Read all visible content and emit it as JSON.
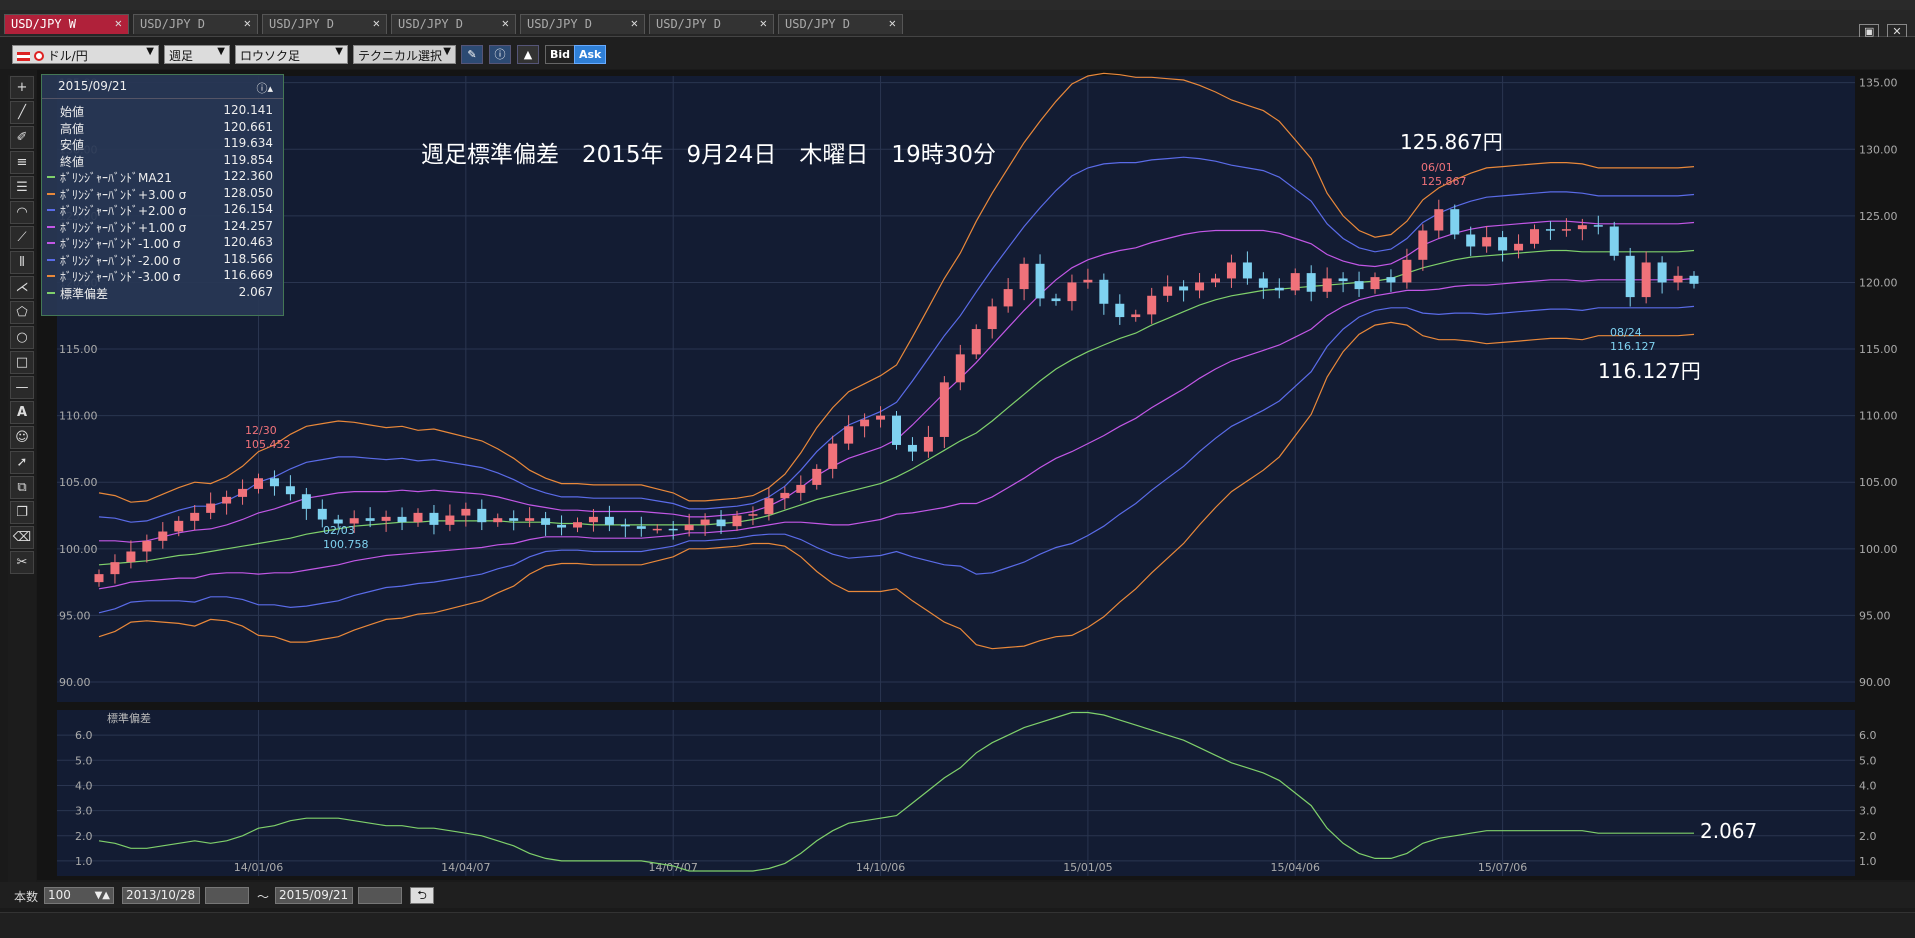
{
  "tabs": [
    {
      "label": "USD/JPY W",
      "active": true
    },
    {
      "label": "USD/JPY D",
      "active": false
    },
    {
      "label": "USD/JPY D",
      "active": false
    },
    {
      "label": "USD/JPY D",
      "active": false
    },
    {
      "label": "USD/JPY D",
      "active": false
    },
    {
      "label": "USD/JPY D",
      "active": false
    },
    {
      "label": "USD/JPY D",
      "active": false
    }
  ],
  "tab_close": "✕",
  "toolbar": {
    "currency": "ドル/円",
    "period": "週足",
    "chart_type": "ロウソク足",
    "technical": "テクニカル選択",
    "bid": "Bid",
    "ask": "Ask"
  },
  "title_overlay": "週足標準偏差　2015年　9月24日　木曜日　19時30分",
  "annotations": {
    "high_price": "125.867円",
    "low_price": "116.127円",
    "stdev_value": "2.067",
    "label_1230_date": "12/30",
    "label_1230_value": "105.452",
    "label_0203_date": "02/03",
    "label_0203_value": "100.758",
    "label_0601_date": "06/01",
    "label_0601_value": "125.867",
    "label_0824_date": "08/24",
    "label_0824_value": "116.127"
  },
  "info_panel": {
    "date": "2015/09/21",
    "rows": [
      {
        "label": "始値",
        "value": "120.141",
        "color": ""
      },
      {
        "label": "高値",
        "value": "120.661",
        "color": ""
      },
      {
        "label": "安値",
        "value": "119.634",
        "color": ""
      },
      {
        "label": "終値",
        "value": "119.854",
        "color": ""
      },
      {
        "label": "ﾎﾞﾘﾝｼﾞｬｰﾊﾞﾝﾄﾞMA21",
        "value": "122.360",
        "color": "#7fd06b"
      },
      {
        "label": "ﾎﾞﾘﾝｼﾞｬｰﾊﾞﾝﾄﾞ+3.00 σ",
        "value": "128.050",
        "color": "#e9883a"
      },
      {
        "label": "ﾎﾞﾘﾝｼﾞｬｰﾊﾞﾝﾄﾞ+2.00 σ",
        "value": "126.154",
        "color": "#5a6be8"
      },
      {
        "label": "ﾎﾞﾘﾝｼﾞｬｰﾊﾞﾝﾄﾞ+1.00 σ",
        "value": "124.257",
        "color": "#c257e6"
      },
      {
        "label": "ﾎﾞﾘﾝｼﾞｬｰﾊﾞﾝﾄﾞ-1.00 σ",
        "value": "120.463",
        "color": "#c257e6"
      },
      {
        "label": "ﾎﾞﾘﾝｼﾞｬｰﾊﾞﾝﾄﾞ-2.00 σ",
        "value": "118.566",
        "color": "#5a6be8"
      },
      {
        "label": "ﾎﾞﾘﾝｼﾞｬｰﾊﾞﾝﾄﾞ-3.00 σ",
        "value": "116.669",
        "color": "#e9883a"
      },
      {
        "label": "標準偏差",
        "value": "2.067",
        "color": "#7fd06b"
      }
    ]
  },
  "bottom": {
    "count_label": "本数",
    "count_value": "100",
    "from_date": "2013/10/28",
    "tilde": "～",
    "to_date": "2015/09/21"
  },
  "colors": {
    "bg": "#131c33",
    "up": "#f0727a",
    "down": "#7fd2f0",
    "ma": "#7fd06b",
    "s1": "#c257e6",
    "s2": "#5a6be8",
    "s3": "#e9883a",
    "grid": "#2a3550"
  },
  "chart_data": {
    "type": "candlestick",
    "main_yticks": [
      "135.00",
      "130.00",
      "125.00",
      "120.00",
      "115.00",
      "110.00",
      "105.00",
      "100.00",
      "95.00",
      "90.00"
    ],
    "main_yrange": [
      88.5,
      135.5
    ],
    "xlabels": [
      {
        "i": 10,
        "label": "14/01/06"
      },
      {
        "i": 23,
        "label": "14/04/07"
      },
      {
        "i": 36,
        "label": "14/07/07"
      },
      {
        "i": 49,
        "label": "14/10/06"
      },
      {
        "i": 62,
        "label": "15/01/05"
      },
      {
        "i": 75,
        "label": "15/04/06"
      },
      {
        "i": 88,
        "label": "15/07/06"
      }
    ],
    "close": [
      98.1,
      99.0,
      99.8,
      100.6,
      101.3,
      102.1,
      102.7,
      103.4,
      103.9,
      104.5,
      105.3,
      104.7,
      104.1,
      103.0,
      102.2,
      101.9,
      102.3,
      102.1,
      102.4,
      102.0,
      102.7,
      101.8,
      102.5,
      103.0,
      102.0,
      102.3,
      102.1,
      102.3,
      101.8,
      101.6,
      102.0,
      102.4,
      101.8,
      101.7,
      101.5,
      101.5,
      101.4,
      101.8,
      102.2,
      101.7,
      102.5,
      102.6,
      103.8,
      104.2,
      104.8,
      106.0,
      107.9,
      109.2,
      109.7,
      110.0,
      107.8,
      107.3,
      108.4,
      112.5,
      114.6,
      116.5,
      118.2,
      119.5,
      121.4,
      118.8,
      118.6,
      120.0,
      120.2,
      118.4,
      117.4,
      117.6,
      119.0,
      119.7,
      119.4,
      120.0,
      120.3,
      121.5,
      120.3,
      119.6,
      119.4,
      120.7,
      119.3,
      120.3,
      120.1,
      119.5,
      120.4,
      120.0,
      121.7,
      123.9,
      125.5,
      123.6,
      122.7,
      123.4,
      122.4,
      122.9,
      124.0,
      123.9,
      124.0,
      124.3,
      124.2,
      122.0,
      118.9,
      121.5,
      120.0,
      120.5,
      119.9
    ],
    "ma": [
      98.8,
      98.9,
      99.0,
      99.1,
      99.3,
      99.5,
      99.6,
      99.8,
      100.0,
      100.2,
      100.4,
      100.6,
      100.8,
      101.1,
      101.3,
      101.5,
      101.7,
      101.8,
      101.9,
      102.0,
      102.0,
      102.1,
      102.1,
      102.1,
      102.1,
      102.1,
      102.0,
      102.0,
      102.0,
      101.9,
      101.9,
      101.8,
      101.8,
      101.8,
      101.8,
      101.8,
      101.8,
      101.8,
      101.8,
      101.9,
      102.0,
      102.2,
      102.5,
      102.9,
      103.3,
      103.7,
      104.0,
      104.3,
      104.6,
      104.9,
      105.4,
      106.0,
      106.7,
      107.4,
      108.1,
      108.7,
      109.6,
      110.6,
      111.6,
      112.6,
      113.5,
      114.2,
      114.8,
      115.3,
      115.8,
      116.2,
      116.8,
      117.3,
      117.8,
      118.3,
      118.7,
      119.0,
      119.2,
      119.4,
      119.5,
      119.6,
      119.7,
      119.8,
      119.9,
      120.0,
      120.1,
      120.3,
      120.7,
      121.1,
      121.4,
      121.7,
      121.9,
      122.0,
      122.1,
      122.2,
      122.3,
      122.4,
      122.4,
      122.3,
      122.3,
      122.3,
      122.3,
      122.3,
      122.3,
      122.3,
      122.4
    ],
    "stdev": [
      1.8,
      1.7,
      1.5,
      1.5,
      1.6,
      1.7,
      1.8,
      1.7,
      1.8,
      2.0,
      2.3,
      2.4,
      2.6,
      2.7,
      2.7,
      2.7,
      2.6,
      2.5,
      2.4,
      2.4,
      2.3,
      2.3,
      2.2,
      2.1,
      2.0,
      1.8,
      1.6,
      1.3,
      1.1,
      1.0,
      1.0,
      1.0,
      1.0,
      1.0,
      1.0,
      0.9,
      0.8,
      0.6,
      0.6,
      0.6,
      0.6,
      0.6,
      0.7,
      0.9,
      1.3,
      1.8,
      2.2,
      2.5,
      2.6,
      2.7,
      2.8,
      3.3,
      3.8,
      4.3,
      4.7,
      5.3,
      5.7,
      6.0,
      6.3,
      6.5,
      6.7,
      6.9,
      6.9,
      6.8,
      6.6,
      6.4,
      6.2,
      6.0,
      5.8,
      5.5,
      5.2,
      4.9,
      4.7,
      4.5,
      4.2,
      3.7,
      3.2,
      2.3,
      1.7,
      1.3,
      1.1,
      1.1,
      1.3,
      1.7,
      1.9,
      2.0,
      2.1,
      2.2,
      2.2,
      2.2,
      2.2,
      2.2,
      2.2,
      2.2,
      2.1,
      2.1,
      2.1,
      2.1,
      2.1,
      2.1,
      2.1
    ],
    "sub_title": "標準偏差",
    "sub_yticks": [
      "6.0",
      "5.0",
      "4.0",
      "3.0",
      "2.0",
      "1.0"
    ],
    "sub_yrange": [
      0.4,
      7.0
    ]
  }
}
